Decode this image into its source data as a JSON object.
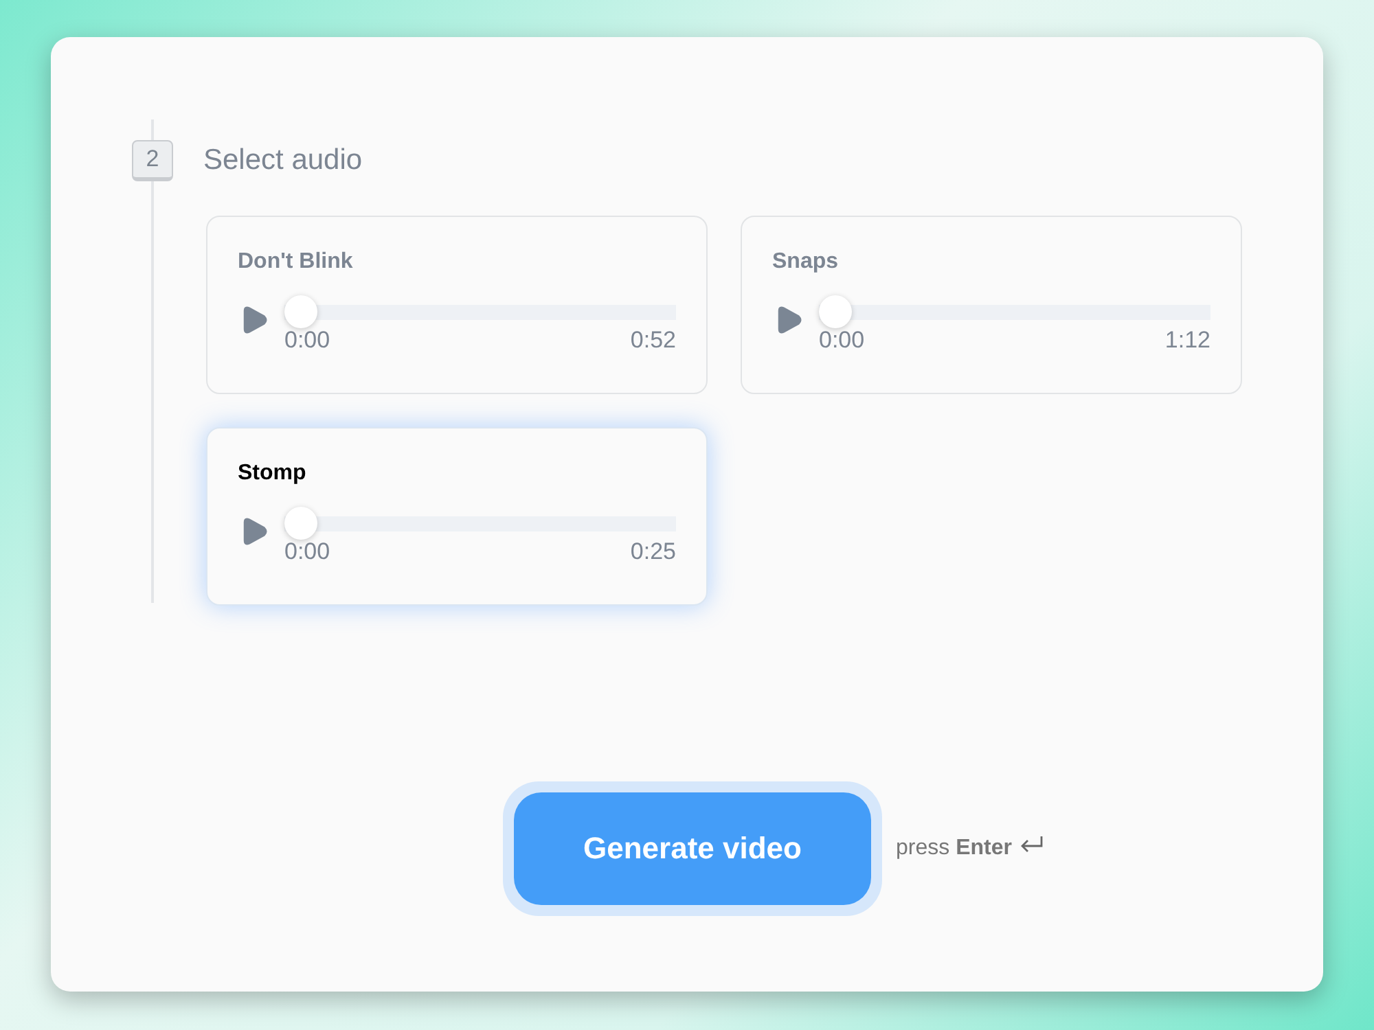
{
  "step": {
    "number": "2",
    "title": "Select audio"
  },
  "tracks": [
    {
      "name": "Don't Blink",
      "selected": false,
      "level": 0,
      "elapsed": "0:00",
      "duration": "0:52"
    },
    {
      "name": "Snaps",
      "selected": false,
      "level": 0,
      "elapsed": "0:00",
      "duration": "1:12"
    },
    {
      "name": "Stomp",
      "selected": true,
      "level": 0,
      "elapsed": "0:00",
      "duration": "0:25"
    }
  ],
  "action": {
    "label": "Generate video",
    "hint": "press **Enter**"
  }
}
